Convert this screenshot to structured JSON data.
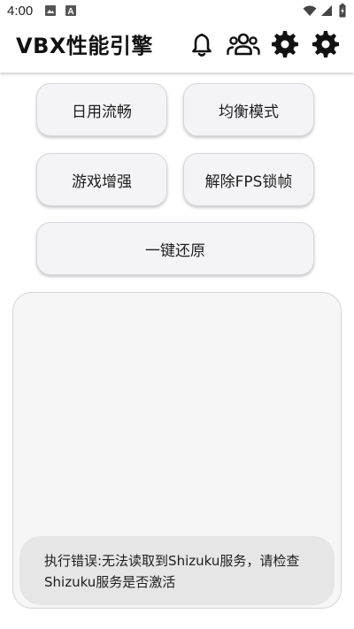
{
  "status_bar": {
    "time": "4:00",
    "icons": [
      "image-icon",
      "a-letter-icon",
      "wifi-icon",
      "signal-icon",
      "battery-charging-icon"
    ]
  },
  "app_bar": {
    "title": "VBX性能引擎",
    "actions": [
      "bell-icon",
      "group-icon",
      "settings-gear-icon",
      "settings-cog-icon"
    ]
  },
  "buttons": {
    "daily_smooth": "日用流畅",
    "balanced_mode": "均衡模式",
    "game_boost": "游戏增强",
    "unlock_fps": "解除FPS锁帧",
    "one_key_restore": "一键还原"
  },
  "toast": {
    "message": "执行错误:无法读取到Shizuku服务，请检查Shizuku服务是否激活"
  }
}
